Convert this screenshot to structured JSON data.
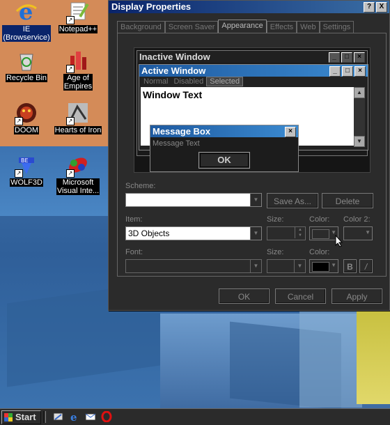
{
  "desktop": {
    "icons": [
      {
        "label": "IE (Browservice)",
        "icon": "internet-explorer-icon"
      },
      {
        "label": "Notepad++",
        "icon": "notepad-plus-plus-icon"
      },
      {
        "label": "Recycle Bin",
        "icon": "recycle-bin-icon"
      },
      {
        "label": "Age of Empires",
        "icon": "age-of-empires-icon"
      },
      {
        "label": "DOOM",
        "icon": "doom-icon"
      },
      {
        "label": "Hearts of Iron",
        "icon": "hearts-of-iron-icon"
      },
      {
        "label": "WOLF3D",
        "icon": "wolf3d-icon"
      },
      {
        "label": "Microsoft Visual Inte...",
        "icon": "visual-interdev-icon"
      }
    ],
    "icon_lines": {
      "ie_1": "IE",
      "ie_2": "(Browservice)",
      "age_1": "Age of",
      "age_2": "Empires",
      "ms_1": "Microsoft",
      "ms_2": "Visual Inte..."
    }
  },
  "dialog": {
    "title": "Display Properties",
    "help_label": "?",
    "close_label": "X",
    "tabs": [
      "Background",
      "Screen Saver",
      "Appearance",
      "Effects",
      "Web",
      "Settings"
    ],
    "active_tab": "Appearance",
    "preview": {
      "inactive_title": "Inactive Window",
      "active_title": "Active Window",
      "menu": [
        "Normal",
        "Disabled",
        "Selected"
      ],
      "window_text": "Window Text",
      "message_title": "Message Box",
      "message_text": "Message Text",
      "ok_label": "OK"
    },
    "scheme_label": "Scheme:",
    "scheme_value": "",
    "save_as_label": "Save As...",
    "delete_label": "Delete",
    "item_label": "Item:",
    "item_value": "3D Objects",
    "size_label": "Size:",
    "color_label": "Color:",
    "color2_label": "Color 2:",
    "font_label": "Font:",
    "font_size_label": "Size:",
    "font_color_label": "Color:",
    "bold_label": "B",
    "italic_label": "/",
    "ok_label": "OK",
    "cancel_label": "Cancel",
    "apply_label": "Apply"
  },
  "taskbar": {
    "start_label": "Start",
    "quicklaunch": [
      "show-desktop-icon",
      "internet-explorer-icon",
      "outlook-express-icon",
      "opera-icon"
    ]
  }
}
